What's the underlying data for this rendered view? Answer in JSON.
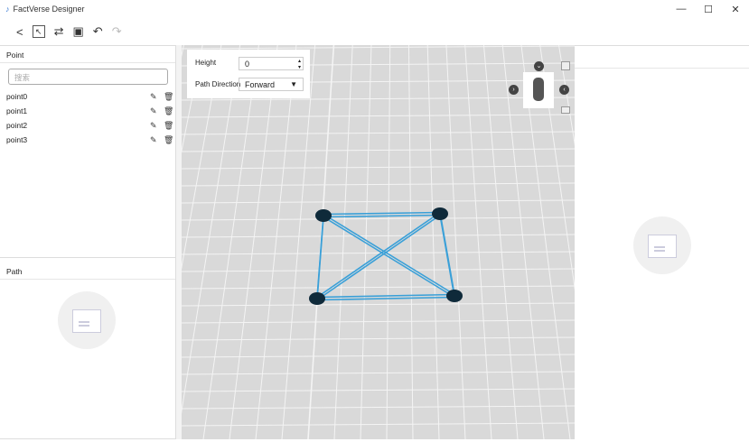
{
  "app": {
    "title": "FactVerse Designer"
  },
  "toolbar": {
    "icons": [
      "back-icon",
      "select-icon",
      "path-icon",
      "save-icon",
      "undo-icon",
      "redo-icon"
    ]
  },
  "point_panel": {
    "title": "Point",
    "search_placeholder": "搜索",
    "items": [
      "point0",
      "point1",
      "point2",
      "point3"
    ]
  },
  "path_panel": {
    "title": "Path"
  },
  "properties": {
    "height_label": "Height",
    "height_value": "0",
    "direction_label": "Path Direction",
    "direction_value": "Forward"
  },
  "colors": {
    "path": "#3aa0d8",
    "point": "#0f2a3a",
    "grid_bg": "#d9d9d9"
  }
}
